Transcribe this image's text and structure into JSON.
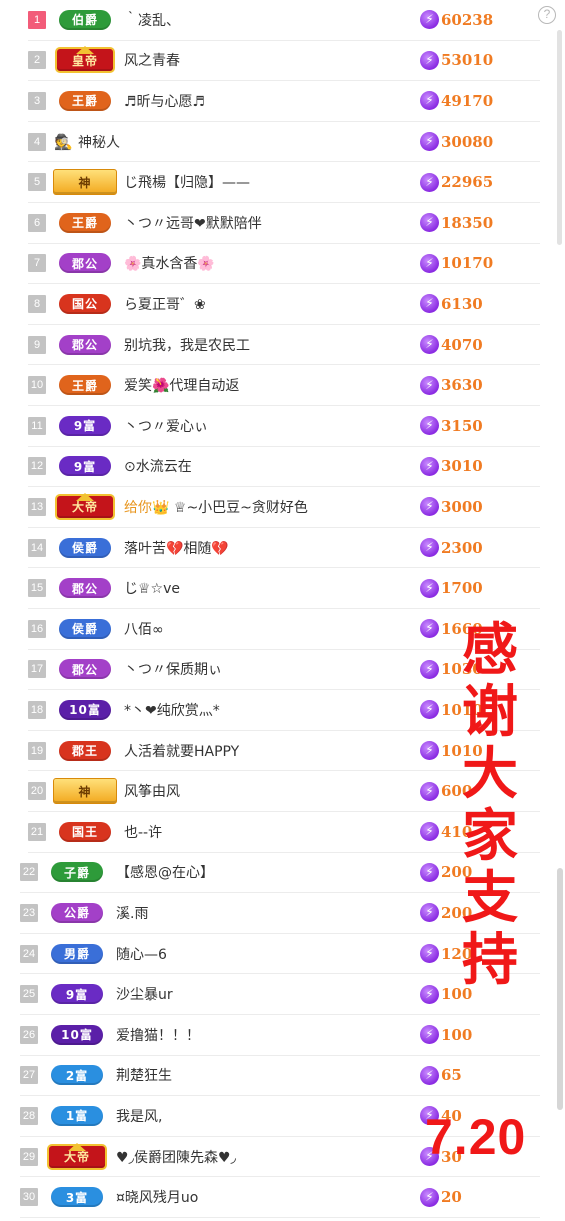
{
  "help_icon": "?",
  "overlay": {
    "thanks": [
      "感",
      "谢",
      "大",
      "家",
      "支",
      "持"
    ],
    "date": "7.20",
    "color": "#f01818"
  },
  "colors": {
    "value": "#f07b22",
    "rank_first": "#f25c79",
    "rank_other": "#c3c3c3",
    "bolt": "#8a2be2"
  },
  "rows": [
    {
      "rank": "1",
      "badge": "伯爵",
      "badge_style": "oval",
      "badge_color": "#2e9b3a",
      "name": "｀凌乱、",
      "value": "60238"
    },
    {
      "rank": "2",
      "badge": "皇帝",
      "badge_style": "crown",
      "badge_color": "#c4141a",
      "name": "风之青春",
      "value": "53010"
    },
    {
      "rank": "3",
      "badge": "王爵",
      "badge_style": "oval",
      "badge_color": "#e0641c",
      "name": "♬昕与心愿♬",
      "value": "49170"
    },
    {
      "rank": "4",
      "badge": "",
      "badge_style": "mystery",
      "badge_color": "",
      "icon": "mystery-person-icon",
      "name": "神秘人",
      "value": "30080"
    },
    {
      "rank": "5",
      "badge": "神",
      "badge_style": "wing",
      "badge_color": "#f2a81e",
      "name": "じ飛楊【归隐】——",
      "value": "22965"
    },
    {
      "rank": "6",
      "badge": "王爵",
      "badge_style": "oval",
      "badge_color": "#e0641c",
      "name": "丶つ〃远哥❤默默陪伴",
      "value": "18350"
    },
    {
      "rank": "7",
      "badge": "郡公",
      "badge_style": "oval",
      "badge_color": "#a340c8",
      "name": "🌸真水含香🌸",
      "value": "10170"
    },
    {
      "rank": "8",
      "badge": "国公",
      "badge_style": "oval",
      "badge_color": "#d8341e",
      "name": "ら夏正哥゛❀",
      "value": "6130"
    },
    {
      "rank": "9",
      "badge": "郡公",
      "badge_style": "oval",
      "badge_color": "#a340c8",
      "name": "别坑我，我是农民工",
      "value": "4070"
    },
    {
      "rank": "10",
      "badge": "王爵",
      "badge_style": "oval",
      "badge_color": "#e0641c",
      "name": "爱笑🌺代理自动返",
      "value": "3630"
    },
    {
      "rank": "11",
      "badge": "9富",
      "badge_style": "oval",
      "badge_color": "#6a2bc4",
      "name": "丶つ〃爱心ぃ",
      "value": "3150"
    },
    {
      "rank": "12",
      "badge": "9富",
      "badge_style": "oval",
      "badge_color": "#6a2bc4",
      "name": "⊙水流云在",
      "value": "3010"
    },
    {
      "rank": "13",
      "badge": "大帝",
      "badge_style": "crown",
      "badge_color": "#c4141a",
      "name_prefix": "给你👑",
      "name": "♕~小巴豆~贪财好色",
      "value": "3000"
    },
    {
      "rank": "14",
      "badge": "侯爵",
      "badge_style": "oval",
      "badge_color": "#3a6fd8",
      "name": "落叶苦💔相随💔",
      "value": "2300"
    },
    {
      "rank": "15",
      "badge": "郡公",
      "badge_style": "oval",
      "badge_color": "#a340c8",
      "name": "じ♕☆ve",
      "value": "1700"
    },
    {
      "rank": "16",
      "badge": "侯爵",
      "badge_style": "oval",
      "badge_color": "#3a6fd8",
      "name": "八佰∞",
      "value": "1660"
    },
    {
      "rank": "17",
      "badge": "郡公",
      "badge_style": "oval",
      "badge_color": "#a340c8",
      "name": "丶つ〃保质期ぃ",
      "value": "1030"
    },
    {
      "rank": "18",
      "badge": "10富",
      "badge_style": "oval",
      "badge_color": "#5b1fa8",
      "name": "*丶❤纯欣赏灬*",
      "value": "1010"
    },
    {
      "rank": "19",
      "badge": "郡王",
      "badge_style": "oval",
      "badge_color": "#d8341e",
      "name": "人活着就要HAPPY",
      "value": "1010"
    },
    {
      "rank": "20",
      "badge": "神",
      "badge_style": "wing",
      "badge_color": "#f2a81e",
      "name": "风筝由风",
      "value": "600"
    },
    {
      "rank": "21",
      "badge": "国王",
      "badge_style": "oval",
      "badge_color": "#d8341e",
      "name": "也--许",
      "value": "410"
    },
    {
      "rank": "22",
      "badge": "子爵",
      "badge_style": "oval",
      "badge_color": "#2e9b3a",
      "name": "【感恩@在心】",
      "value": "200"
    },
    {
      "rank": "23",
      "badge": "公爵",
      "badge_style": "oval",
      "badge_color": "#a340c8",
      "name": "溪.雨",
      "value": "200"
    },
    {
      "rank": "24",
      "badge": "男爵",
      "badge_style": "oval",
      "badge_color": "#3a6fd8",
      "name": "随心—6",
      "value": "120"
    },
    {
      "rank": "25",
      "badge": "9富",
      "badge_style": "oval",
      "badge_color": "#6a2bc4",
      "name": "沙尘暴ur",
      "value": "100"
    },
    {
      "rank": "26",
      "badge": "10富",
      "badge_style": "oval",
      "badge_color": "#5b1fa8",
      "name": "爱撸猫！！！",
      "value": "100"
    },
    {
      "rank": "27",
      "badge": "2富",
      "badge_style": "oval",
      "badge_color": "#2a8fe0",
      "name": "荆楚狂生",
      "value": "65"
    },
    {
      "rank": "28",
      "badge": "1富",
      "badge_style": "oval",
      "badge_color": "#2a8fe0",
      "name": "我是风,",
      "value": "40"
    },
    {
      "rank": "29",
      "badge": "大帝",
      "badge_style": "crown",
      "badge_color": "#c4141a",
      "name": "♥◞侯爵团陳先森♥◞",
      "value": "30"
    },
    {
      "rank": "30",
      "badge": "3富",
      "badge_style": "oval",
      "badge_color": "#2a8fe0",
      "name": "¤晓风残月uo",
      "value": "20"
    }
  ]
}
